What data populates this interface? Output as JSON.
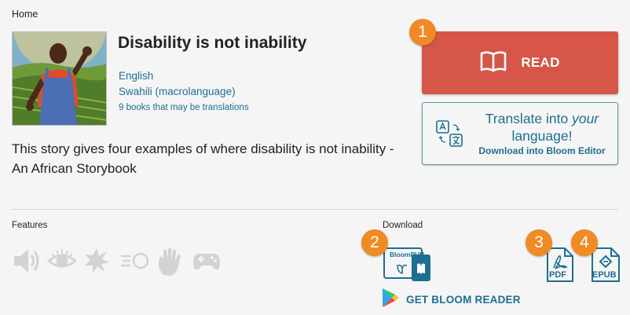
{
  "breadcrumb": {
    "home": "Home"
  },
  "book": {
    "title": "Disability is not inability",
    "languages": [
      "English",
      "Swahili (macrolanguage)"
    ],
    "translations": "9 books that may be translations",
    "summary": "This story gives four examples of where disability is not inability - An African Storybook"
  },
  "actions": {
    "read_label": "READ",
    "translate_line1_prefix": "Translate into ",
    "translate_line1_emph": "your",
    "translate_line1_suffix": "language!",
    "translate_line2": "Download into Bloom Editor"
  },
  "features": {
    "label": "Features",
    "icons": [
      "audio-icon",
      "eye-icon",
      "activity-icon",
      "sign-language-icon",
      "hand-icon",
      "game-controller-icon"
    ]
  },
  "download": {
    "label": "Download",
    "bloompub_label": "BloomPUB",
    "pdf_label": "PDF",
    "epub_label": "EPUB",
    "get_reader": "GET BLOOM READER"
  },
  "callouts": [
    "1",
    "2",
    "3",
    "4"
  ],
  "colors": {
    "read_button": "#d65649",
    "link": "#1d6f91",
    "callout": "#f08a24",
    "feature_icon": "#d3d3d3"
  }
}
